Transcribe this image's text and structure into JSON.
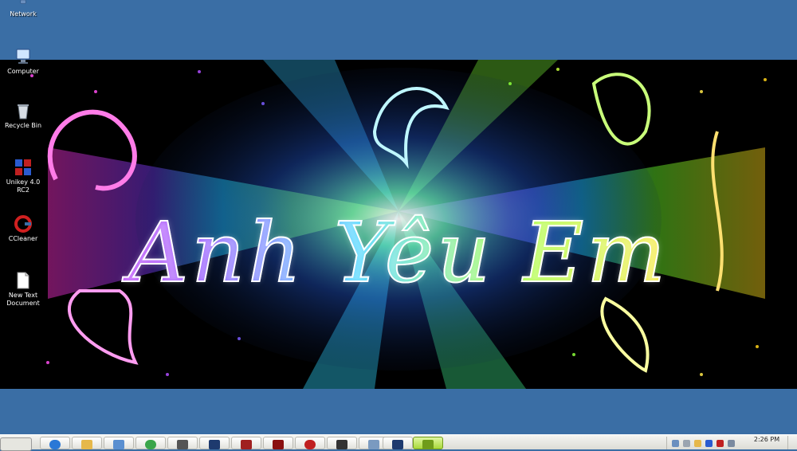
{
  "desktop": {
    "background_color": "#3a6ea5",
    "icons": [
      {
        "label": "Network",
        "icon": "network-icon"
      },
      {
        "label": "Computer",
        "icon": "computer-icon"
      },
      {
        "label": "Recycle Bin",
        "icon": "recycle-bin-icon"
      },
      {
        "label": "Unikey 4.0 RC2",
        "icon": "unikey-icon"
      },
      {
        "label": "CCleaner",
        "icon": "ccleaner-icon"
      },
      {
        "label": "New Text Document",
        "icon": "text-document-icon"
      }
    ]
  },
  "wallpaper": {
    "text": "Anh Yêu Em"
  },
  "taskbar": {
    "clock": "2:26 PM",
    "buttons": [
      {
        "icon": "ie-icon",
        "color": "#2a78d6"
      },
      {
        "icon": "folder-icon",
        "color": "#e6b84a"
      },
      {
        "icon": "media-icon",
        "color": "#5a8fd0"
      },
      {
        "icon": "chrome-icon",
        "color": "#3aa54a"
      },
      {
        "icon": "people-icon",
        "color": "#555555"
      },
      {
        "icon": "photoshop-icon",
        "color": "#1e3a6e"
      },
      {
        "icon": "app-icon",
        "color": "#a02020"
      },
      {
        "icon": "app2-icon",
        "color": "#8a1010"
      },
      {
        "icon": "record-icon",
        "color": "#c02020"
      },
      {
        "icon": "film-icon",
        "color": "#333333"
      },
      {
        "icon": "window-icon",
        "color": "#7a9ac0"
      },
      {
        "icon": "photoshop2-icon",
        "color": "#1e3a6e"
      },
      {
        "icon": "screen-icon",
        "color": "#6f9c1a"
      }
    ]
  }
}
